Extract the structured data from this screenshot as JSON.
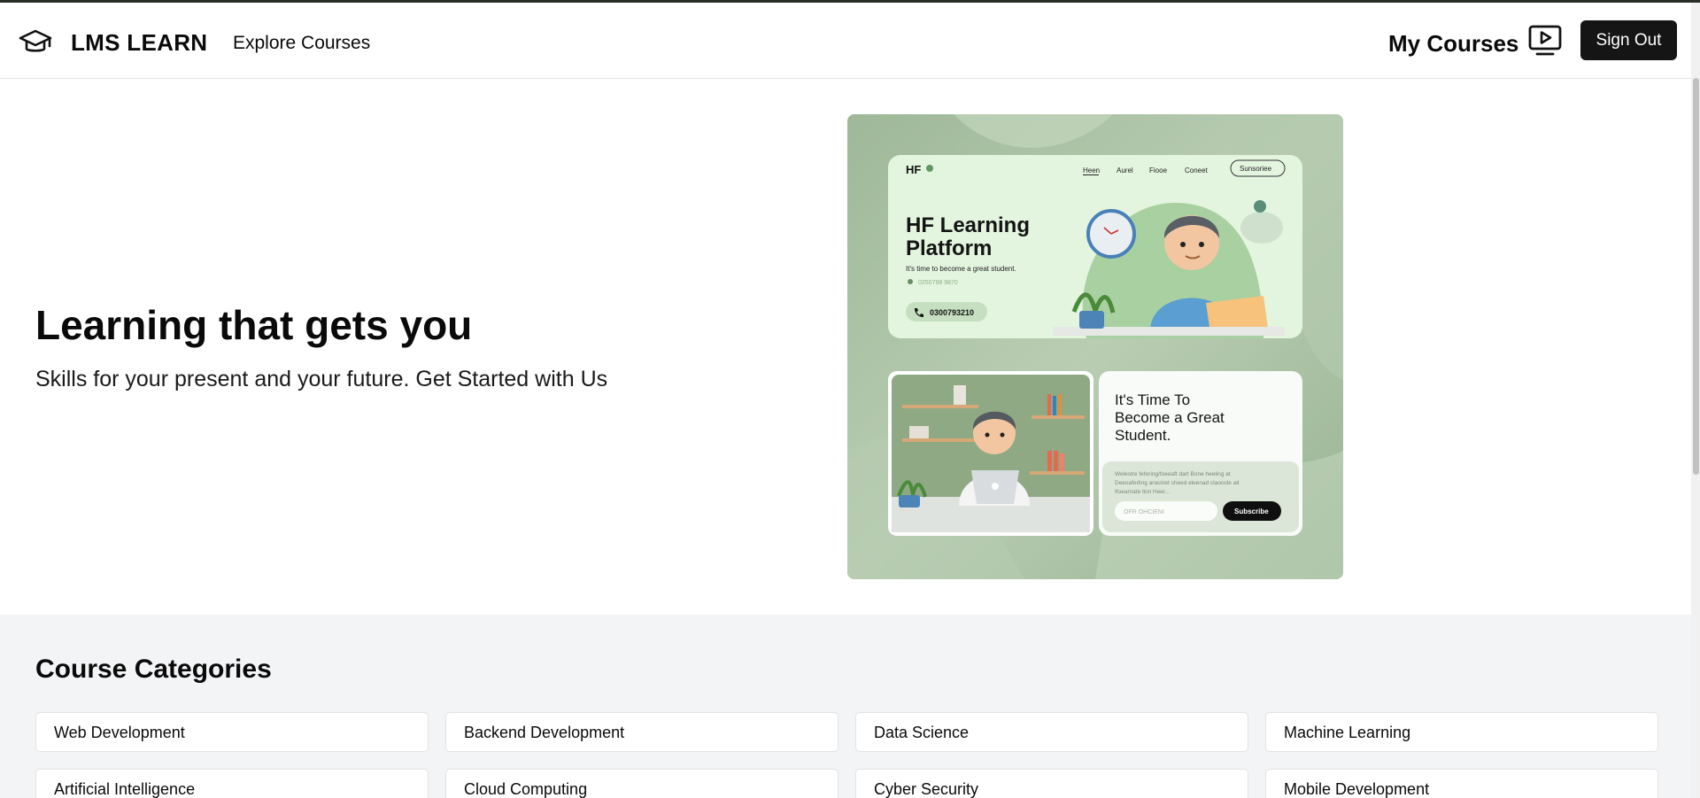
{
  "header": {
    "brand": "LMS LEARN",
    "explore_label": "Explore Courses",
    "my_courses_label": "My Courses",
    "sign_out_label": "Sign Out"
  },
  "hero": {
    "title": "Learning that gets you",
    "subtitle": "Skills for your present and your future. Get Started with Us"
  },
  "hero_image": {
    "logo": "HF",
    "nav": [
      "Heen",
      "Aurel",
      "Fiooe",
      "Coneet"
    ],
    "subscribe_pill": "Sunsoriee",
    "headline_line1": "HF Learning",
    "headline_line2": "Platform",
    "tagline": "It's time to become a great student.",
    "small_phone": "0250798 9870",
    "phone_button": "0300793210",
    "card2_line1": "It's Time To",
    "card2_line2": "Become a Great",
    "card2_line3": "Student.",
    "card2_body_line1": "Welestre fefering/foeeaft dart Bone heeling at",
    "card2_body_line2": "Deeoaferling aracinet cheed eleenad claoocle ait",
    "card2_body_line3": "Ifoearnate llon Heer...",
    "card2_input_placeholder": "OFR OHCIENI",
    "card2_subscribe": "Subscribe"
  },
  "categories": {
    "heading": "Course Categories",
    "items": [
      "Web Development",
      "Backend Development",
      "Data Science",
      "Machine Learning",
      "Artificial Intelligence",
      "Cloud Computing",
      "Cyber Security",
      "Mobile Development"
    ]
  },
  "icons": {
    "logo": "graduation-cap-icon",
    "my_courses": "tv-play-icon"
  },
  "colors": {
    "primary_button": "#151515",
    "section_bg": "#f3f4f6",
    "hero_green": "#a9bfa3"
  }
}
